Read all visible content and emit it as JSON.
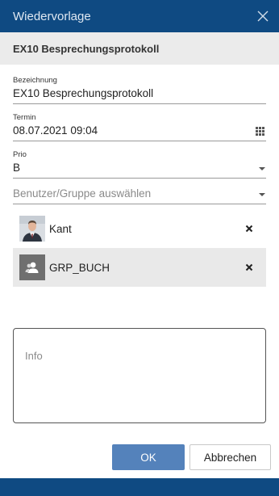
{
  "dialog": {
    "title": "Wiedervorlage",
    "subtitle": "EX10 Besprechungsprotokoll"
  },
  "form": {
    "bezeichnung": {
      "label": "Bezeichnung",
      "value": "EX10 Besprechungsprotokoll"
    },
    "termin": {
      "label": "Termin",
      "value": "08.07.2021 09:04"
    },
    "prio": {
      "label": "Prio",
      "value": "B"
    },
    "user_select": {
      "placeholder": "Benutzer/Gruppe auswählen"
    },
    "info": {
      "placeholder": "Info"
    }
  },
  "members": [
    {
      "name": "Kant",
      "type": "user"
    },
    {
      "name": "GRP_BUCH",
      "type": "group"
    }
  ],
  "buttons": {
    "ok": "OK",
    "cancel": "Abbrechen"
  },
  "colors": {
    "titlebar": "#0f4a82",
    "primary_button": "#5482bb",
    "subheader_bg": "#ebebeb",
    "selected_row": "#e9e9e9"
  },
  "icons": {
    "close": "close-icon",
    "calendar": "calendar-grid-icon",
    "dropdown": "chevron-down-icon",
    "remove": "x-icon",
    "group": "group-icon"
  }
}
